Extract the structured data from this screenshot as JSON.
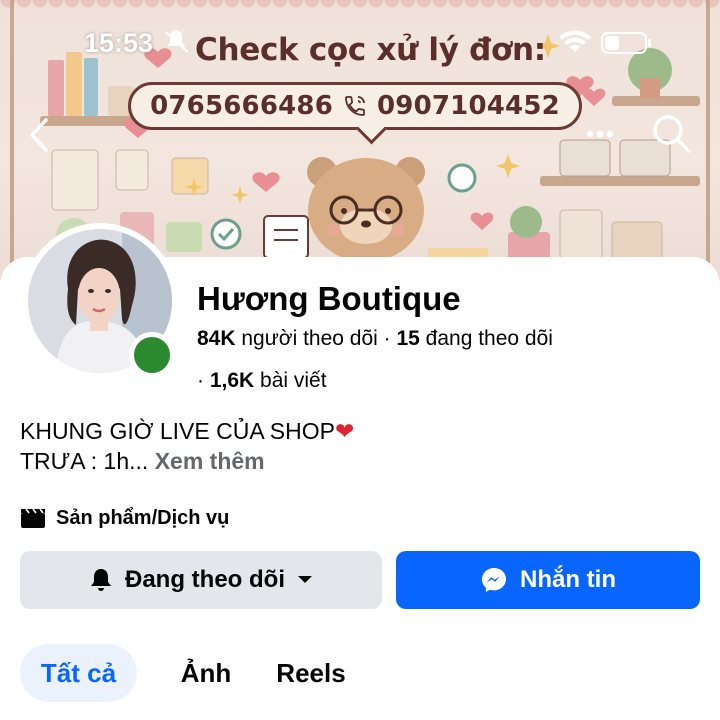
{
  "status_bar": {
    "time": "15:53"
  },
  "cover": {
    "title": "Check cọc xử lý đơn:",
    "phone1": "0765666486",
    "phone2": "0907104452"
  },
  "profile": {
    "name": "Hương Boutique",
    "followers_count": "84K",
    "followers_label": "người theo dõi",
    "following_count": "15",
    "following_label": "đang theo dõi",
    "posts_count": "1,6K",
    "posts_label": "bài viết",
    "bio_line1": "KHUNG GIỜ LIVE CỦA SHOP",
    "bio_line2": "TRƯA : 1h...",
    "see_more": "Xem thêm",
    "category": "Sản phẩm/Dịch vụ"
  },
  "actions": {
    "follow_label": "Đang theo dõi",
    "message_label": "Nhắn tin"
  },
  "tabs": [
    {
      "label": "Tất cả"
    },
    {
      "label": "Ảnh"
    },
    {
      "label": "Reels"
    }
  ],
  "colors": {
    "accent_blue": "#0866ff",
    "online_green": "#2b8a2f",
    "banner_text": "#5a2e2a"
  },
  "icons": [
    "back-arrow-icon",
    "more-icon",
    "search-icon",
    "bell-icon",
    "caret-down-icon",
    "messenger-icon",
    "clapper-icon",
    "phone-icon",
    "mute-icon",
    "wifi-icon",
    "battery-icon",
    "heart-icon"
  ]
}
